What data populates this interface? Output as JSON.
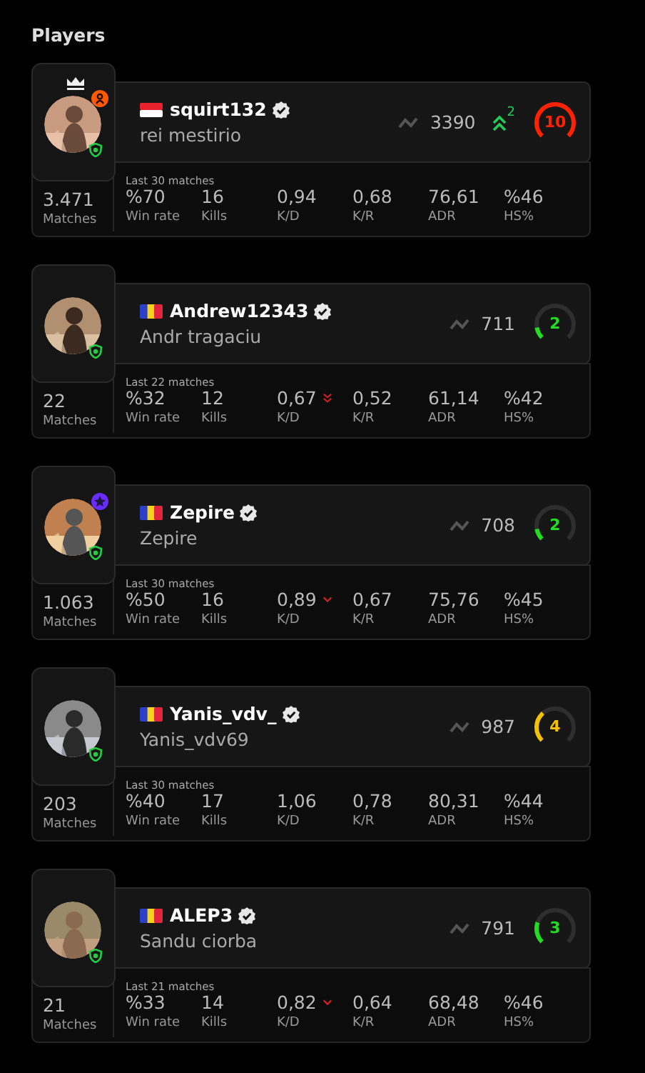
{
  "title": "Players",
  "players": [
    {
      "flag": {
        "kind": "indonesia"
      },
      "name": "squirt132",
      "nickname": "rei mestirio",
      "elo": "3390",
      "elo_change": "2",
      "skill_level": "10",
      "color": "#ff2200",
      "crown": true,
      "badge": {
        "kind": "person",
        "color": "#ff5a00"
      },
      "matches_note": "Last 30 matches",
      "matches": {
        "value": "3.471",
        "label": "Matches"
      },
      "stats": [
        {
          "value": "%70",
          "label": "Win rate"
        },
        {
          "value": "16",
          "label": "Kills"
        },
        {
          "value": "0,94",
          "label": "K/D"
        },
        {
          "value": "0,68",
          "label": "K/R"
        },
        {
          "value": "76,61",
          "label": "ADR"
        },
        {
          "value": "%46",
          "label": "HS%"
        }
      ]
    },
    {
      "flag": {
        "kind": "romania"
      },
      "name": "Andrew12343",
      "nickname": "Andr tragaciu",
      "elo": "711",
      "skill_level": "2",
      "color": "#22dd22",
      "crown": false,
      "matches_note": "Last 22 matches",
      "matches": {
        "value": "22",
        "label": "Matches"
      },
      "stats": [
        {
          "value": "%32",
          "label": "Win rate"
        },
        {
          "value": "12",
          "label": "Kills"
        },
        {
          "value": "0,67",
          "label": "K/D",
          "trend": {
            "kind": "down2"
          }
        },
        {
          "value": "0,52",
          "label": "K/R"
        },
        {
          "value": "61,14",
          "label": "ADR"
        },
        {
          "value": "%42",
          "label": "HS%"
        }
      ]
    },
    {
      "flag": {
        "kind": "romania"
      },
      "name": "Zepire",
      "nickname": "Zepire",
      "elo": "708",
      "skill_level": "2",
      "color": "#22dd22",
      "crown": false,
      "badge": {
        "kind": "star",
        "color": "#6a2cff"
      },
      "matches_note": "Last 30 matches",
      "matches": {
        "value": "1.063",
        "label": "Matches"
      },
      "stats": [
        {
          "value": "%50",
          "label": "Win rate"
        },
        {
          "value": "16",
          "label": "Kills"
        },
        {
          "value": "0,89",
          "label": "K/D",
          "trend": {
            "kind": "down"
          }
        },
        {
          "value": "0,67",
          "label": "K/R"
        },
        {
          "value": "75,76",
          "label": "ADR"
        },
        {
          "value": "%45",
          "label": "HS%"
        }
      ]
    },
    {
      "flag": {
        "kind": "romania"
      },
      "name": "Yanis_vdv_",
      "nickname": "Yanis_vdv69",
      "elo": "987",
      "skill_level": "4",
      "color": "#f5c000",
      "crown": false,
      "matches_note": "Last 30 matches",
      "matches": {
        "value": "203",
        "label": "Matches"
      },
      "stats": [
        {
          "value": "%40",
          "label": "Win rate"
        },
        {
          "value": "17",
          "label": "Kills"
        },
        {
          "value": "1,06",
          "label": "K/D"
        },
        {
          "value": "0,78",
          "label": "K/R"
        },
        {
          "value": "80,31",
          "label": "ADR"
        },
        {
          "value": "%44",
          "label": "HS%"
        }
      ]
    },
    {
      "flag": {
        "kind": "romania"
      },
      "name": "ALEP3",
      "nickname": "Sandu ciorba",
      "elo": "791",
      "skill_level": "3",
      "color": "#22dd22",
      "crown": false,
      "matches_note": "Last 21 matches",
      "matches": {
        "value": "21",
        "label": "Matches"
      },
      "stats": [
        {
          "value": "%33",
          "label": "Win rate"
        },
        {
          "value": "14",
          "label": "Kills"
        },
        {
          "value": "0,82",
          "label": "K/D",
          "trend": {
            "kind": "down"
          }
        },
        {
          "value": "0,64",
          "label": "K/R"
        },
        {
          "value": "68,48",
          "label": "ADR"
        },
        {
          "value": "%46",
          "label": "HS%"
        }
      ]
    }
  ]
}
